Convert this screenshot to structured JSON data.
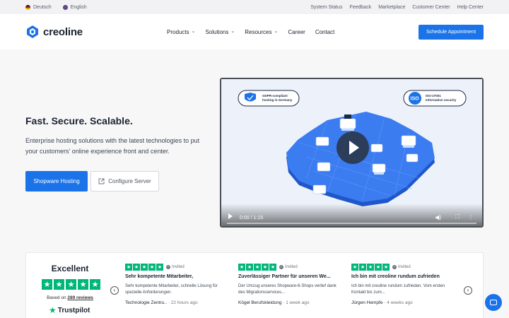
{
  "topbar": {
    "languages": [
      "Deutsch",
      "English"
    ],
    "links": [
      "System Status",
      "Feedback",
      "Marketplace",
      "Customer Center",
      "Help Center"
    ]
  },
  "header": {
    "logo_text": "creoline",
    "nav": [
      {
        "label": "Products",
        "dropdown": true
      },
      {
        "label": "Solutions",
        "dropdown": true
      },
      {
        "label": "Resources",
        "dropdown": true
      },
      {
        "label": "Career",
        "dropdown": false
      },
      {
        "label": "Contact",
        "dropdown": false
      }
    ],
    "cta_label": "Schedule Appointment"
  },
  "hero": {
    "title": "Fast. Secure. Scalable.",
    "subtitle": "Enterprise hosting solutions with the latest technologies to put your customers' online experience front and center.",
    "primary_button": "Shopware Hosting",
    "secondary_button": "Configure Server"
  },
  "video": {
    "badge_left": "GDPR-compliant hosting in Germany",
    "badge_right": "ISO-27001 Information security",
    "iso_label": "ISO",
    "time": "0:00 / 1:15",
    "progress": 0
  },
  "reviews": {
    "rating_word": "Excellent",
    "based_on_prefix": "Based on",
    "based_on_count": "289 reviews",
    "brand": "Trustpilot",
    "invited_label": "Invited",
    "cards": [
      {
        "title": "Sehr kompetente Mitarbeiter,",
        "body": "Sehr kompetente Mitarbeiter, schnelle Lösung für spezielle Anforderungen.",
        "author": "Technologie Zentru..",
        "ago": "22 hours ago"
      },
      {
        "title": "Zuverlässiger Partner für unseren We...",
        "body": "Der Umzug unseres Shopware-6-Shops verlief dank des Migrationsservices...",
        "author": "Kögel Berufskleidung",
        "ago": "1 week ago"
      },
      {
        "title": "Ich bin mit creoline rundum zufrieden",
        "body": "Ich bin mit creoline rundum zufrieden. Vom ersten Kontakt bis zum...",
        "author": "Jürgen Hempfe",
        "ago": "4 weeks ago"
      }
    ]
  },
  "colors": {
    "accent": "#1a73e8",
    "trustpilot": "#00b67a"
  },
  "icons": [
    "flag-de-icon",
    "flag-en-icon",
    "creoline-logo-icon",
    "chevron-down-icon",
    "external-link-icon",
    "play-icon",
    "volume-icon",
    "fullscreen-icon",
    "more-icon",
    "chevron-left-icon",
    "chevron-right-icon",
    "chat-icon"
  ]
}
